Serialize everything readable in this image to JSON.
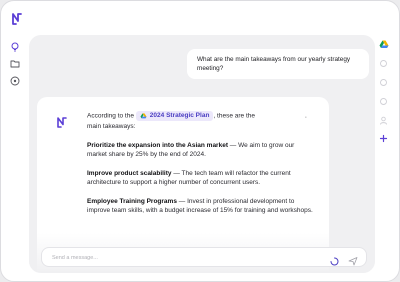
{
  "user_message": "What are the main takeaways from our yearly strategy meeting?",
  "assistant": {
    "intro_before": "According to the",
    "chip_label": "2024 Strategic Plan",
    "intro_after": ", these are the",
    "intro_trailing": ".",
    "intro_line2": "main takeaways:",
    "points": [
      {
        "title": "Prioritize the expansion into the Asian market",
        "body": " — We aim to grow our market share by 25% by the end of 2024."
      },
      {
        "title": "Improve product scalability",
        "body": " — The tech team will refactor the current architecture to support a higher number of concurrent users."
      },
      {
        "title": "Employee Training Programs",
        "body": " — Invest in professional development to improve team skills, with a budget increase of 15% for training and workshops."
      }
    ]
  },
  "composer": {
    "placeholder": "Send a message..."
  },
  "colors": {
    "accent": "#5b3fd6",
    "chip_bg": "#ece8fb"
  },
  "icons": {
    "left_rail": [
      "lightbulb-icon",
      "folder-icon",
      "compass-icon"
    ],
    "right_rail": [
      "google-drive-icon",
      "grid-icon",
      "star-icon",
      "user-icon",
      "person-icon",
      "plus-icon"
    ]
  }
}
